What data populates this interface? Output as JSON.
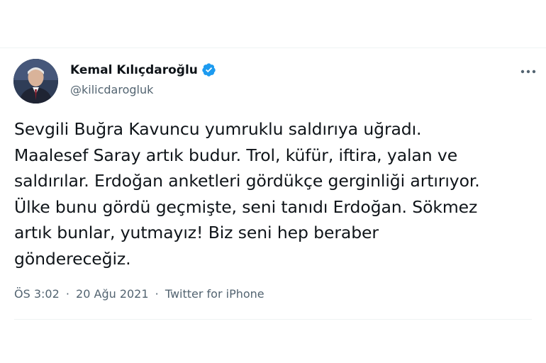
{
  "tweet": {
    "author": {
      "display_name": "Kemal Kılıçdaroğlu",
      "handle": "@kilicdarogluk",
      "verified": true
    },
    "text_lines": [
      "Sevgili Buğra Kavuncu yumruklu saldırıya uğradı.",
      "Maalesef Saray artık budur. Trol, küfür, iftira, yalan ve",
      "saldırılar. Erdoğan anketleri gördükçe gerginliği artırıyor.",
      "Ülke bunu gördü geçmişte, seni tanıdı Erdoğan. Sökmez",
      "artık bunlar, yutmayız! Biz seni hep beraber",
      "göndereceğiz."
    ],
    "meta": {
      "time": "ÖS 3:02",
      "separator": "·",
      "date": "20 Ağu 2021",
      "source": "Twitter for iPhone"
    }
  },
  "icons": {
    "verified": "verified-badge-icon",
    "more": "more-options-icon"
  },
  "colors": {
    "text_primary": "#0f1419",
    "text_secondary": "#536471",
    "verified_blue": "#1d9bf0",
    "divider": "#eff3f4"
  }
}
